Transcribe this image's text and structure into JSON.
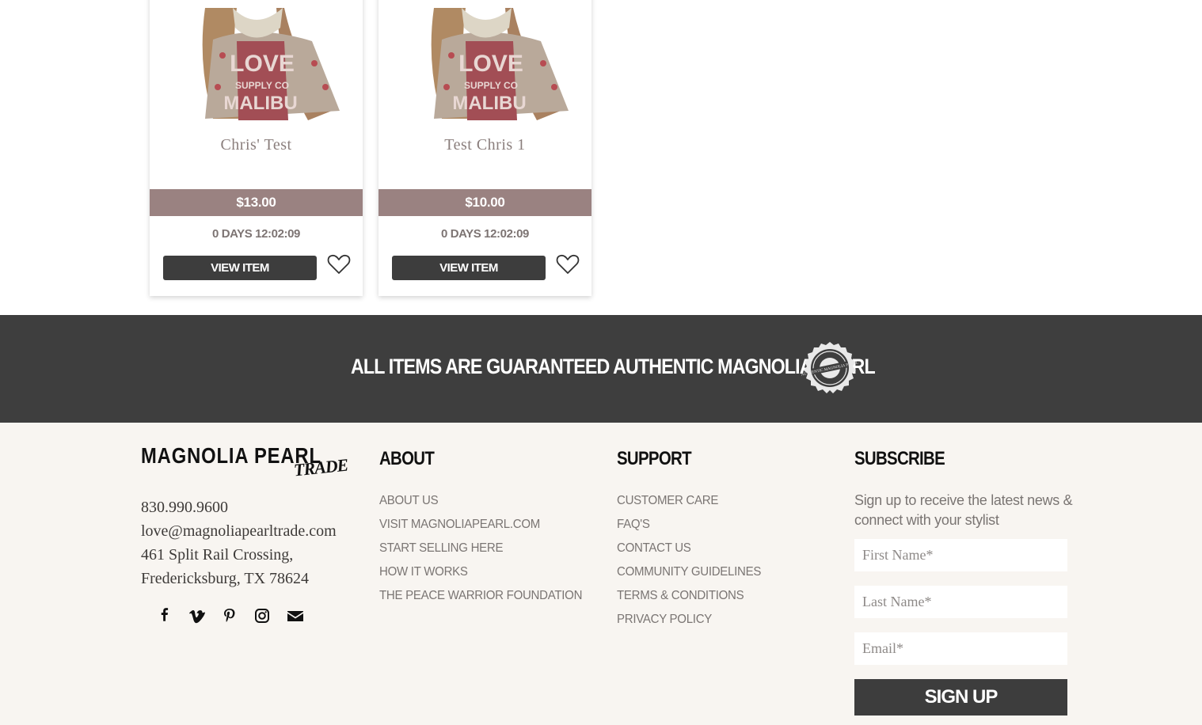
{
  "products": [
    {
      "name": "Chris' Test",
      "price": "$13.00",
      "timer": "0 DAYS 12:02:09",
      "view_label": "VIEW ITEM",
      "image_icon": "product-photo-model"
    },
    {
      "name": "Test Chris 1",
      "price": "$10.00",
      "timer": "0 DAYS 12:02:09",
      "view_label": "VIEW ITEM",
      "image_icon": "product-photo-model"
    }
  ],
  "banner": {
    "text": "ALL ITEMS ARE GUARANTEED AUTHENTIC MAGNOLIA PEARL",
    "seal_icon": "authentic-magnolia-pearl-seal",
    "seal_text": "AUTHENTIC MAGNOLIA PEARL"
  },
  "footer": {
    "logo_main": "MAGNOLIA PEARL",
    "logo_sub": "TRADE",
    "phone": "830.990.9600",
    "email": "love@magnoliapearltrade.com",
    "address_line1": "461 Split Rail Crossing,",
    "address_line2": "Fredericksburg, TX 78624",
    "social": [
      "facebook-icon",
      "vimeo-icon",
      "pinterest-icon",
      "instagram-icon",
      "email-icon"
    ],
    "about": {
      "heading": "ABOUT",
      "links": [
        "ABOUT US",
        "VISIT MAGNOLIAPEARL.COM",
        "START SELLING HERE",
        "HOW IT WORKS",
        "THE PEACE WARRIOR FOUNDATION"
      ]
    },
    "support": {
      "heading": "SUPPORT",
      "links": [
        "CUSTOMER CARE",
        "FAQ'S",
        "CONTACT US",
        "COMMUNITY GUIDELINES",
        "TERMS & CONDITIONS",
        "PRIVACY POLICY"
      ]
    },
    "subscribe": {
      "heading": "SUBSCRIBE",
      "description": "Sign up to receive the latest news & connect with your stylist",
      "first_name_placeholder": "First Name*",
      "last_name_placeholder": "Last Name*",
      "email_placeholder": "Email*",
      "button_label": "SIGN UP"
    }
  },
  "colors": {
    "price_bar": "#9a8281",
    "dark": "#3e3e3e",
    "footer_bg": "#f8f5f1",
    "link_text": "#7a7573"
  }
}
